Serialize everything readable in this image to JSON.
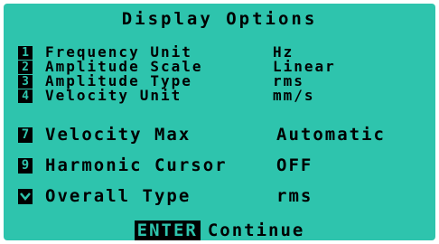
{
  "title": "Display Options",
  "options_top": [
    {
      "key": "1",
      "label": "Frequency Unit",
      "value": "Hz"
    },
    {
      "key": "2",
      "label": "Amplitude Scale",
      "value": "Linear"
    },
    {
      "key": "3",
      "label": "Amplitude Type",
      "value": "rms"
    },
    {
      "key": "4",
      "label": "Velocity Unit",
      "value": "mm/s"
    }
  ],
  "options_bottom": [
    {
      "key": "7",
      "label": "Velocity Max",
      "value": "Automatic"
    },
    {
      "key": "9",
      "label": "Harmonic Cursor",
      "value": "OFF"
    },
    {
      "key": "chevron-down",
      "label": "Overall Type",
      "value": "rms"
    }
  ],
  "footer": {
    "key": "ENTER",
    "label": "Continue"
  },
  "colors": {
    "background": "#2ec4ad",
    "foreground": "#000000"
  }
}
